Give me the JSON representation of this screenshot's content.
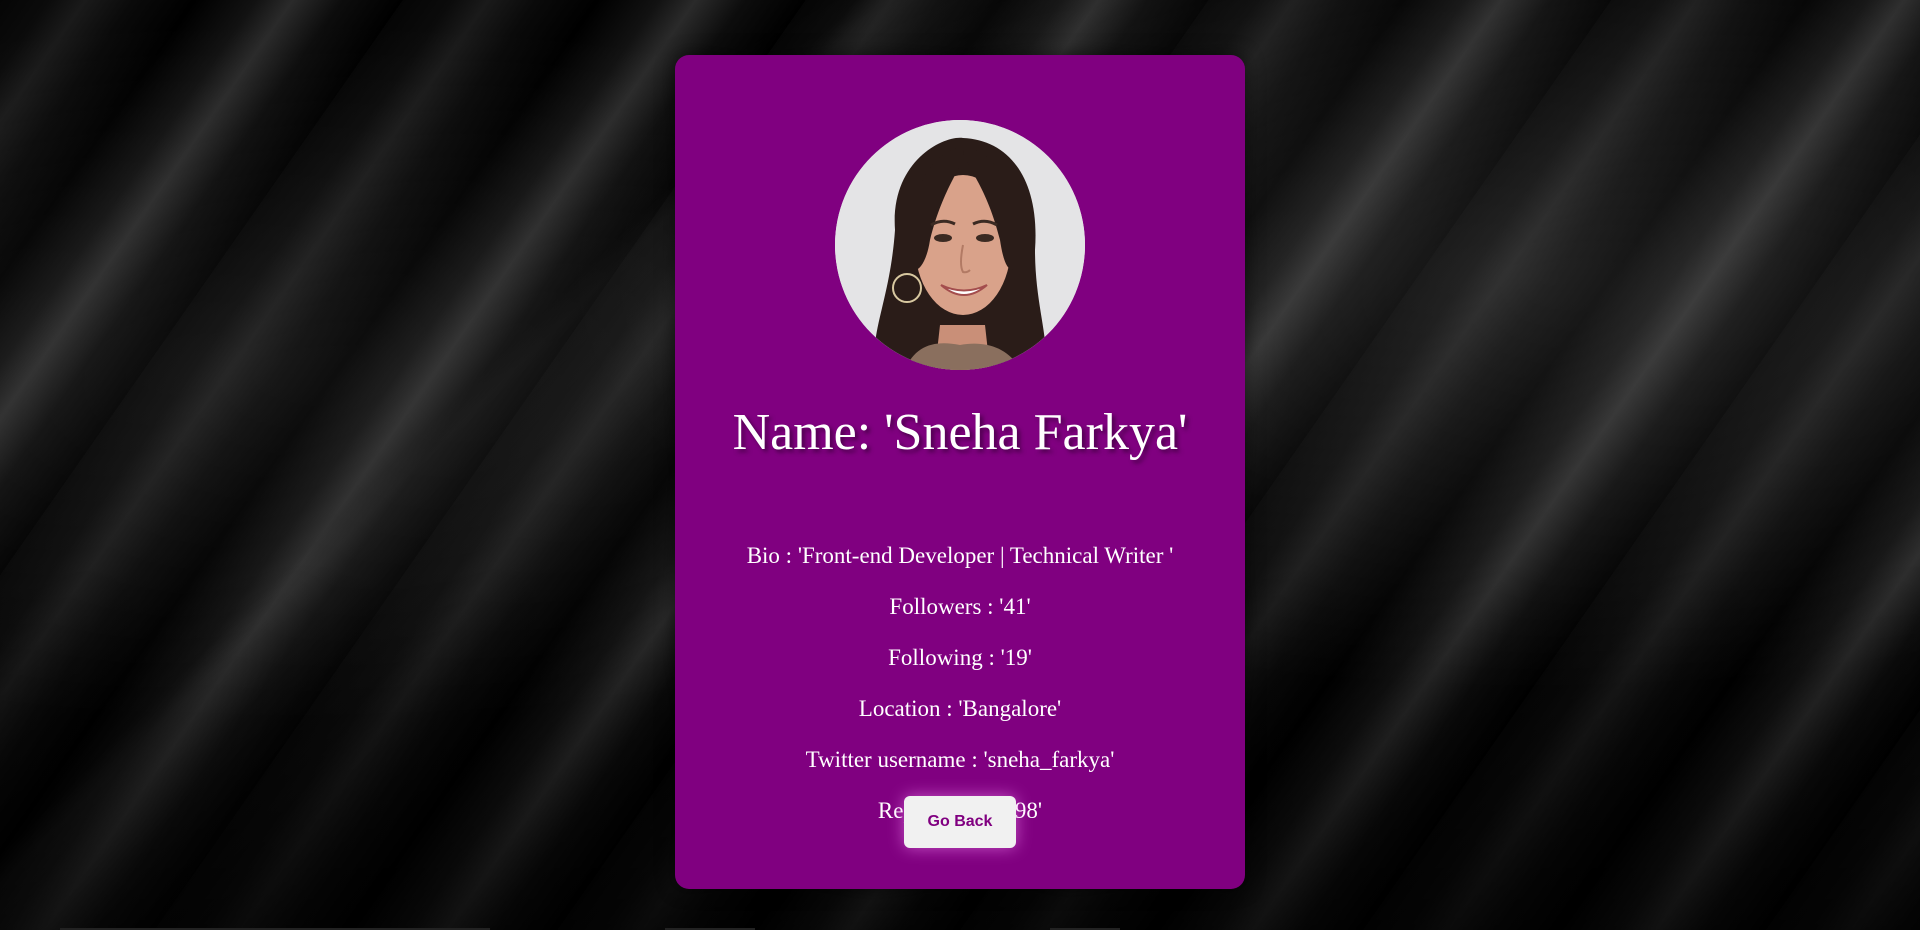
{
  "profile": {
    "name": "Name: 'Sneha Farkya'",
    "bio": "Bio : 'Front-end Developer | Technical Writer '",
    "followers": "Followers : '41'",
    "following": "Following : '19'",
    "location": "Location : 'Bangalore'",
    "twitter": "Twitter username : 'sneha_farkya'",
    "repositories": "Repositories : '98'",
    "avatar_alt": "Profile photo"
  },
  "actions": {
    "go_back_label": "Go Back"
  },
  "colors": {
    "card_background": "#800080",
    "button_text": "#800080",
    "page_background": "#000000"
  }
}
